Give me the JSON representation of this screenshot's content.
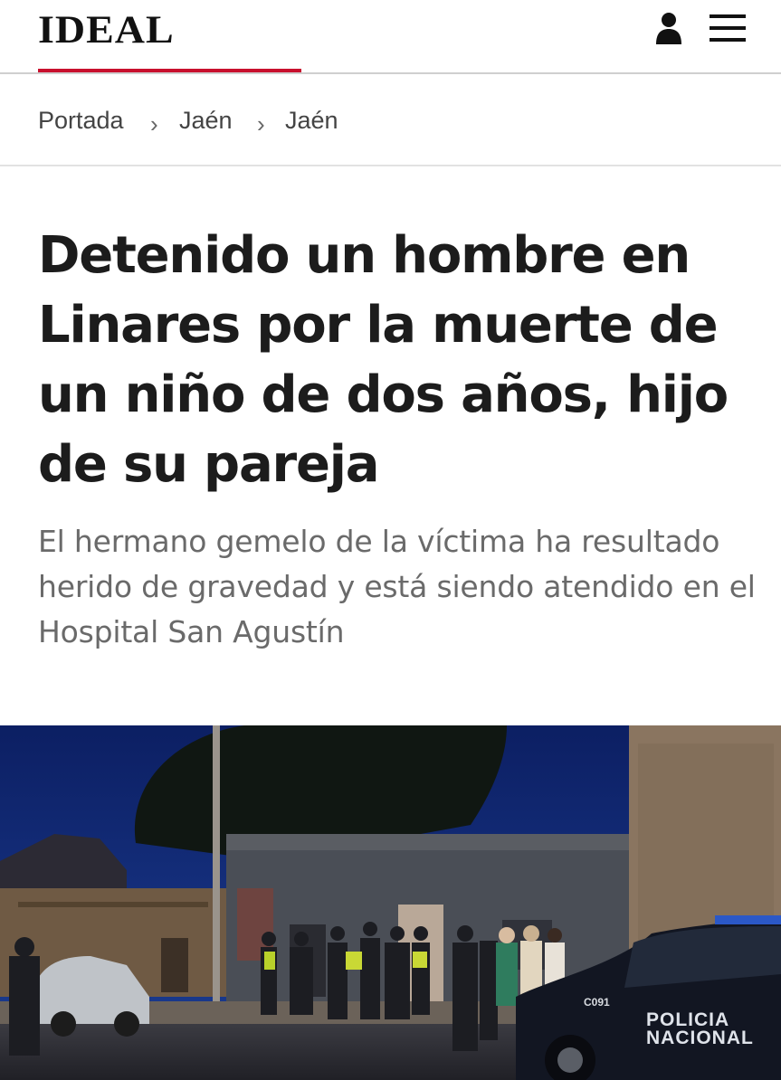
{
  "header": {
    "logo": "IDEAL",
    "brand_color": "#c8102e",
    "icons": [
      "user-icon",
      "hamburger-menu-icon"
    ]
  },
  "breadcrumb": {
    "items": [
      {
        "label": "Portada"
      },
      {
        "label": "Jaén"
      },
      {
        "label": "Jaén"
      }
    ],
    "separator_icon": "chevron-right-icon"
  },
  "article": {
    "headline": "Detenido un hombre en Linares por la muerte de un niño de dos años, hijo de su pareja",
    "subheadline": "El hermano gemelo de la víctima ha resultado herido de gravedad y está siendo atendido en el Hospital San Agustín"
  },
  "photo": {
    "vehicle_text_line1": "POLICIA",
    "vehicle_text_line2": "NACIONAL",
    "vehicle_code": "C091"
  }
}
